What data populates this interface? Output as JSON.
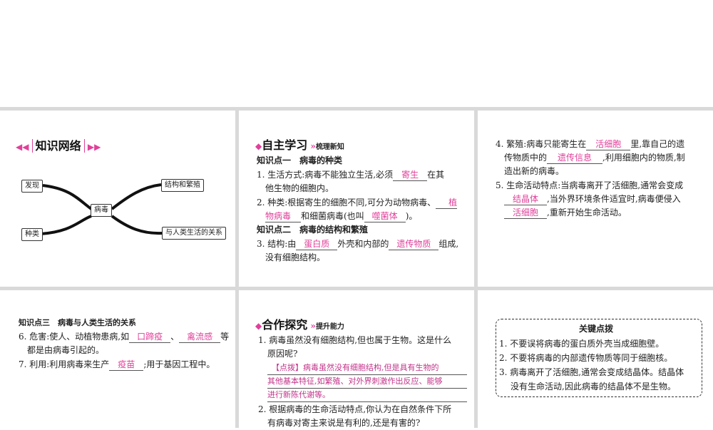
{
  "network": {
    "title": "知识网络",
    "center": "病毒",
    "nodes": [
      "发现",
      "种类",
      "结构和繁殖",
      "与人类生活的关系"
    ]
  },
  "self_study": {
    "title": "自主学习",
    "subtitle": "梳理新知",
    "kp1": "知识点一　病毒的种类",
    "i1a": "1. 生活方式:病毒不能独立生活,必须",
    "i1b1": "寄生",
    "i1c": "在其",
    "i1d": "他生物的细胞内。",
    "i2a": "2. 种类:根据寄生的细胞不同,可分为动物病毒、",
    "i2b1": "植",
    "i2b2": "物病毒",
    "i2c": "和细菌病毒(也叫",
    "i2b3": "噬菌体",
    "i2d": ")。",
    "kp2": "知识点二　病毒的结构和繁殖",
    "i3a": "3. 结构:由",
    "i3b1": "蛋白质",
    "i3c": "外壳和内部的",
    "i3b2": "遗传物质",
    "i3d": "组成,",
    "i3e": "没有细胞结构。"
  },
  "col3": {
    "i4a": "4. 繁殖:病毒只能寄生在",
    "i4b1": "活细胞",
    "i4c": "里,靠自己的遗",
    "i4d": "传物质中的",
    "i4b2": "遗传信息",
    "i4e": ",利用细胞内的物质,制",
    "i4f": "造出新的病毒。",
    "i5a": "5. 生命活动特点:当病毒离开了活细胞,通常会变成",
    "i5b1": "结晶体",
    "i5c": ",当外界环境条件适宜时,病毒便侵入",
    "i5b2": "活细胞",
    "i5d": ",重新开始生命活动。"
  },
  "kp3": {
    "title": "知识点三　病毒与人类生活的关系",
    "i6a": "6. 危害:使人、动植物患病,如",
    "i6b1": "口蹄疫",
    "i6c": "、",
    "i6b2": "禽流感",
    "i6d": "等",
    "i6e": "都是由病毒引起的。",
    "i7a": "7. 利用:利用病毒来生产",
    "i7b": "疫苗",
    "i7c": ";用于基因工程中。"
  },
  "coop": {
    "title": "合作探究",
    "subtitle": "提升能力",
    "q1a": "1. 病毒虽然没有细胞结构,但也属于生物。这是什么",
    "q1b": "原因呢?",
    "h1": "【点拨】病毒虽然没有细胞结构,但是具有生物的",
    "h2": "其他基本特征,如繁殖、对外界刺激作出反应、能够",
    "h3": "进行新陈代谢等。",
    "q2a": "2. 根据病毒的生命活动特点,你认为在自然条件下所",
    "q2b": "有病毒对寄主来说是有利的,还是有害的?"
  },
  "key": {
    "title": "关键点拨",
    "l1": "1. 不要误将病毒的蛋白质外壳当成细胞壁。",
    "l2": "2. 不要将病毒的内部遗传物质等同于细胞核。",
    "l3": "3. 病毒离开了活细胞,通常会变成结晶体。结晶体",
    "l4": "没有生命活动,因此病毒的结晶体不是生物。"
  },
  "accent": "#e0409a"
}
